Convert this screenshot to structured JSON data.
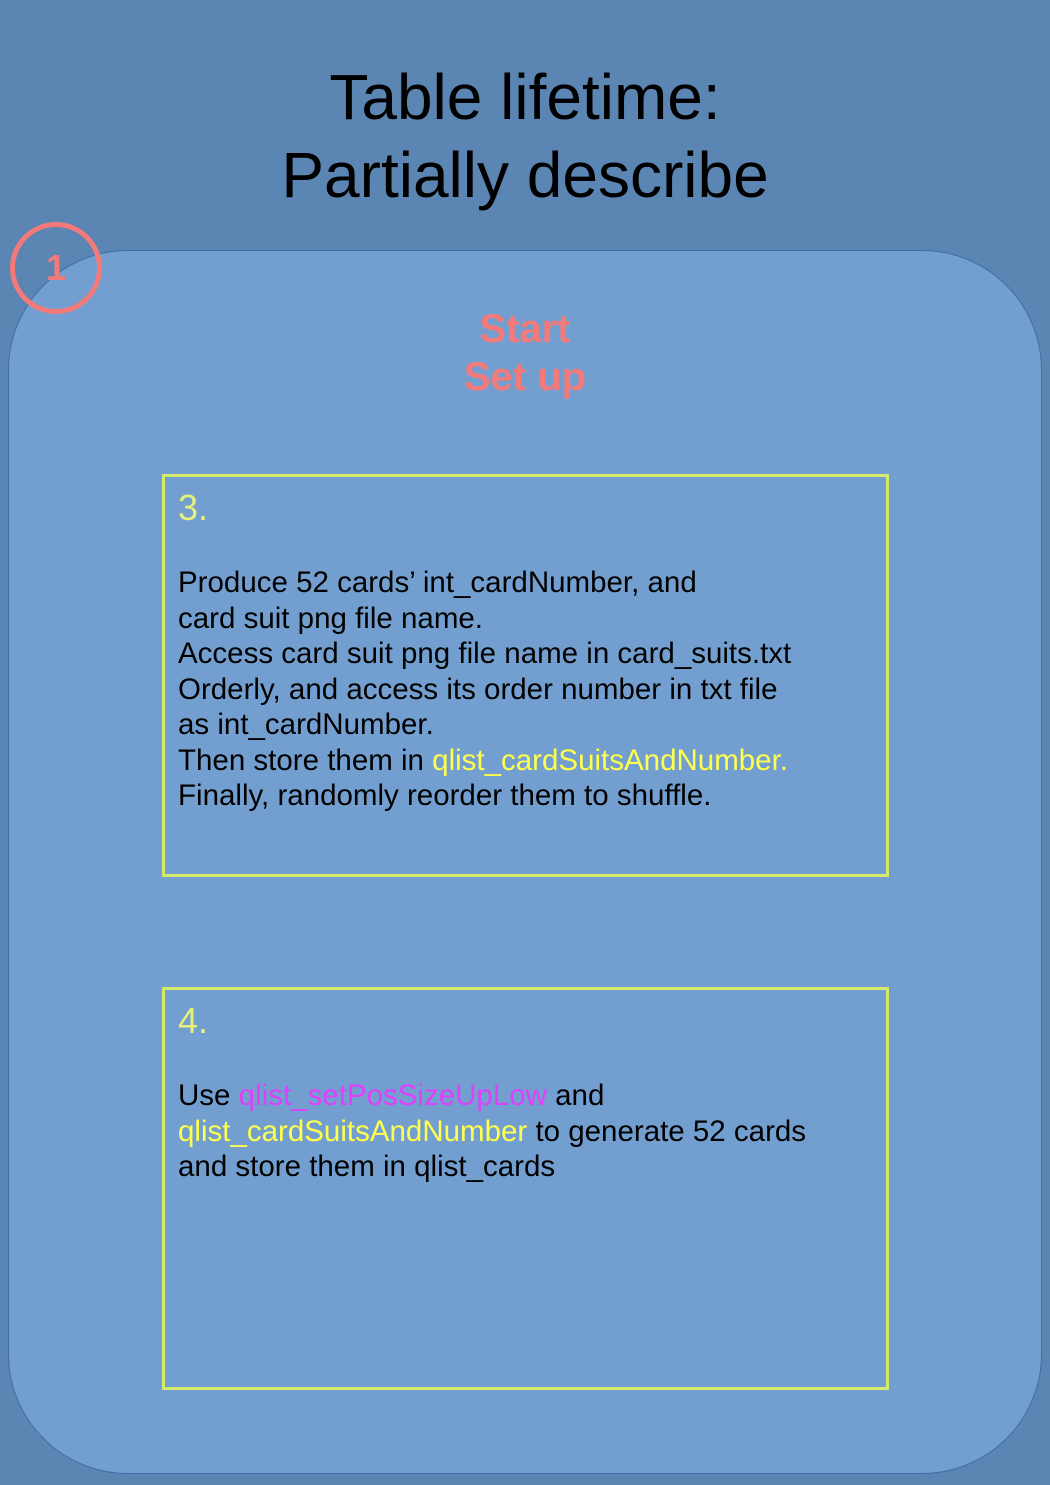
{
  "title": {
    "line1": "Table lifetime:",
    "line2": "Partially describe"
  },
  "step_marker": "1",
  "phase": {
    "line1": "Start",
    "line2": "Set up"
  },
  "box3": {
    "number": "3.",
    "lines": [
      "Produce 52 cards’ int_cardNumber, and",
      "card suit png file name.",
      "Access card suit png file name in card_suits.txt",
      "Orderly, and access its order number in txt file",
      "as int_cardNumber."
    ],
    "line6_prefix": "Then store them in ",
    "line6_highlight": "qlist_cardSuitsAndNumber.",
    "line7": "Finally, randomly reorder them to shuffle."
  },
  "box4": {
    "number": "4.",
    "line1_prefix": "Use ",
    "line1_highlight": "qlist_setPosSizeUpLow",
    "line1_suffix": " and",
    "line2_highlight": "qlist_cardSuitsAndNumber",
    "line2_suffix": " to generate 52 cards",
    "line3": "and store them in qlist_cards"
  },
  "colors": {
    "background": "#5b85b3",
    "panel": "#729fcf",
    "accent_red": "#f47a7a",
    "box_border": "#d4ea6b",
    "highlight_yellow": "#ffff4d",
    "highlight_magenta": "#e040fb"
  }
}
